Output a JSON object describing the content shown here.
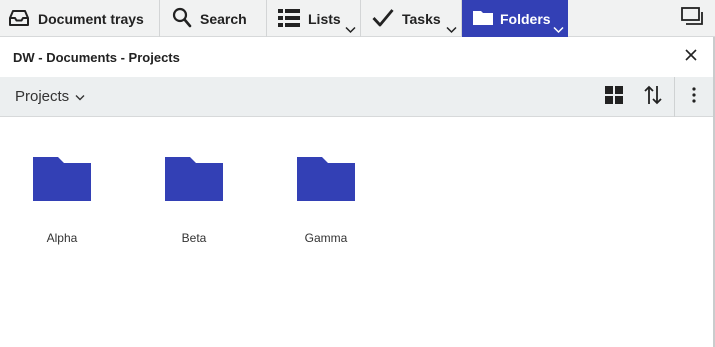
{
  "nav": {
    "tabs": [
      {
        "label": "Document trays",
        "icon": "tray-icon"
      },
      {
        "label": "Search",
        "icon": "search-icon"
      },
      {
        "label": "Lists",
        "icon": "list-icon",
        "has_dropdown": true
      },
      {
        "label": "Tasks",
        "icon": "checkmark-icon",
        "has_dropdown": true
      },
      {
        "label": "Folders",
        "icon": "folder-icon",
        "has_dropdown": true,
        "active": true
      }
    ],
    "window_icon": "window-restore-icon"
  },
  "panel": {
    "title": "DW - Documents - Projects",
    "close_icon": "close-icon"
  },
  "toolbar": {
    "view_label": "Projects",
    "view_icon": "chevron-down-icon",
    "grid_icon": "grid-view-icon",
    "sort_icon": "sort-icon",
    "more_icon": "more-vertical-icon"
  },
  "folders": [
    {
      "name": "Alpha"
    },
    {
      "name": "Beta"
    },
    {
      "name": "Gamma"
    }
  ],
  "colors": {
    "accent": "#3340b5",
    "folder": "#3340b5",
    "topbar_bg": "#f1f2f2",
    "toolbar_bg": "#eceff0"
  }
}
